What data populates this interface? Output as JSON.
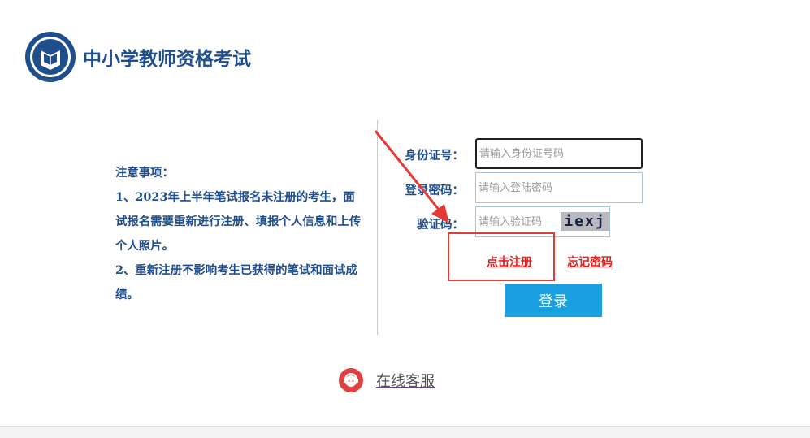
{
  "header": {
    "title": "中小学教师资格考试",
    "logo_icon": "teacher-certification-logo"
  },
  "notice": {
    "title": "注意事项：",
    "item1": "1、2023年上半年笔试报名未注册的考生，面试报名需要重新进行注册、填报个人信息和上传个人照片。",
    "item2": "2、重新注册不影响考生已获得的笔试和面试成绩。"
  },
  "form": {
    "id_label": "身份证号：",
    "id_placeholder": "请输入身份证号码",
    "password_label": "登录密码：",
    "password_placeholder": "请输入登陆密码",
    "captcha_label": "验证码：",
    "captcha_placeholder": "请输入验证码",
    "captcha_text": "iexj",
    "register_link": "点击注册",
    "forgot_link": "忘记密码",
    "login_button": "登录"
  },
  "support": {
    "label": "在线客服",
    "icon": "customer-service-icon"
  },
  "colors": {
    "brand": "#1f4e8c",
    "accent": "#1aa0e0",
    "link_red": "#e02020",
    "annotation_red": "#e53935"
  }
}
